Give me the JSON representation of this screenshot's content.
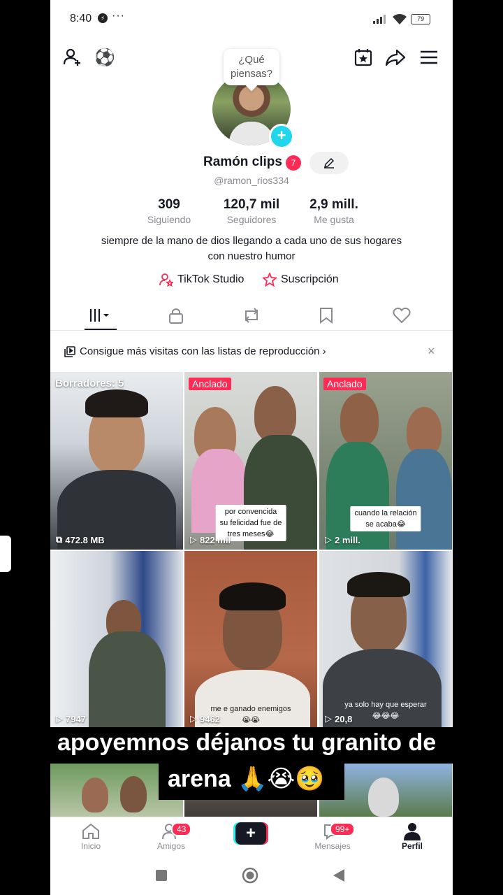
{
  "status": {
    "time": "8:40",
    "dots": "···",
    "battery": "79"
  },
  "bubble": "¿Qué piensas?",
  "profile": {
    "name": "Ramón clips",
    "badge": "7",
    "handle": "@ramon_rios334",
    "stats": [
      {
        "value": "309",
        "label": "Siguiendo"
      },
      {
        "value": "120,7 mil",
        "label": "Seguidores"
      },
      {
        "value": "2,9 mill.",
        "label": "Me gusta"
      }
    ],
    "bio_line1": "siempre de la mano de dios llegando a cada uno de sus hogares",
    "bio_line2": "con nuestro humor",
    "link1": "TikTok Studio",
    "link2": "Suscripción"
  },
  "banner": {
    "text": "Consigue más visitas con las listas de reproducción ›",
    "close": "×"
  },
  "grid": [
    {
      "top_label": "Borradores: 5",
      "bottom": "472.8 MB"
    },
    {
      "top_label": "Anclado",
      "bottom": "822 mil",
      "caption": "por convencida\nsu felicidad fue de\ntres meses😂"
    },
    {
      "top_label": "Anclado",
      "bottom": "2 mill.",
      "caption": "cuando la relación\nse acaba😂"
    },
    {
      "bottom": "7947"
    },
    {
      "bottom": "9462",
      "caption": "me e ganado enemigos\n😭😭"
    },
    {
      "bottom": "20,8",
      "caption": "ya solo hay que esperar\n😂😂😂"
    }
  ],
  "overlay": {
    "line1": "apoyemnos déjanos tu granito de",
    "line2": "arena 🙏😭🥹"
  },
  "nav": {
    "home": "Inicio",
    "friends": "Amigos",
    "friends_badge": "43",
    "create": "+",
    "inbox": "Mensajes",
    "inbox_badge": "99+",
    "profile": "Perfil"
  }
}
